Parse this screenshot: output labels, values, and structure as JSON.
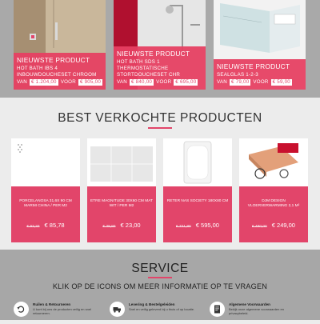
{
  "top_products": [
    {
      "kicker": "NIEUWSTE PRODUCT",
      "name": "HOT BATH IBS 4 INBOUWDOUCHESET CHROOM",
      "price_prefix": "VAN",
      "old_price": "€ 1.204,00",
      "price_mid": "VOOR",
      "new_price": "€ 905,00"
    },
    {
      "kicker": "NIEUWSTE PRODUCT",
      "name": "HOT BATH SDS 1 THERMOSTATISCHE STORTDOUCHESET CHR",
      "price_prefix": "VAN",
      "old_price": "€ 840,00",
      "price_mid": "VOOR",
      "new_price": "€ 695,00"
    },
    {
      "kicker": "NIEUWSTE PRODUCT",
      "name": "SEALGLAS 1-2-3",
      "price_prefix": "VAN",
      "old_price": "€ 79,00",
      "price_mid": "VOOR",
      "new_price": "€ 59,00"
    }
  ],
  "best_sellers": {
    "title": "BEST VERKOCHTE PRODUCTEN",
    "products": [
      {
        "name": "PORCELANOSA 31,6X 90 CM MARMI CHINA / PER M2",
        "old_price": "€ 93,20",
        "price": "€ 85,78"
      },
      {
        "name": "ETRE MAGNITUDE 30X60 CM MAT WIT / PER M2",
        "old_price": "€ 39,80",
        "price": "€ 23,00"
      },
      {
        "name": "RETER NAS SOCIETY 180X80 CM",
        "old_price": "€ 721,80",
        "price": "€ 595,00"
      },
      {
        "name": "DJM DESIGN VLOERVERWARMING 2,1 M²",
        "old_price": "€ 480,00",
        "price": "€ 249,00"
      }
    ]
  },
  "service": {
    "title": "SERVICE",
    "subtitle": "KLIK OP DE ICONS OM MEER INFORMATIE OP TE VRAGEN",
    "items": [
      {
        "title": "Ruilen & Retourneren",
        "desc": "U kunt bij ons de producten veilig en snel retourneren.",
        "icon": "return-icon"
      },
      {
        "title": "Levering & Bestelgeleiden",
        "desc": "Snel en veilig geleverd bij u thuis of op locatie.",
        "icon": "delivery-icon"
      },
      {
        "title": "Algemene Voorwaarden",
        "desc": "Bekijk onze algemene voorwaarden en privacybeleid.",
        "icon": "document-icon"
      }
    ]
  },
  "colors": {
    "accent": "#e2456a",
    "top_bg": "#a9a9a9",
    "service_bg": "#a7a7a7",
    "page_bg": "#ececec"
  }
}
